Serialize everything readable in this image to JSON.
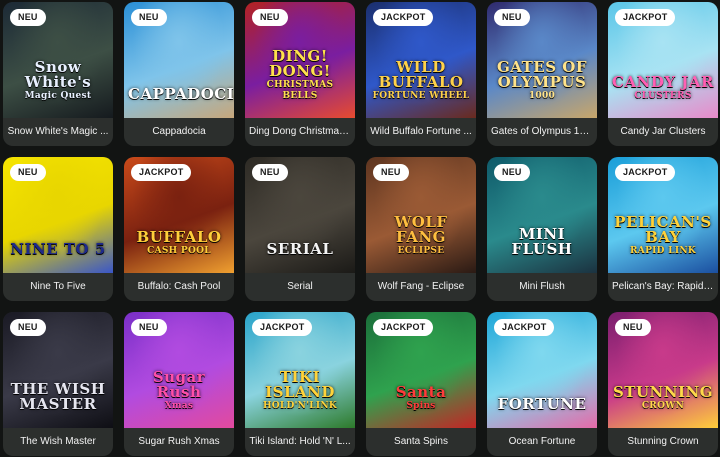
{
  "games": [
    {
      "title": "Snow White's Magic ...",
      "badge": "NEU",
      "logo": "Snow White's",
      "logo_sub": "Magic Quest",
      "colors": [
        "#1c2a36",
        "#3d4f45",
        "#151a1e"
      ],
      "logo_color": "#e8f0ff"
    },
    {
      "title": "Cappadocia",
      "badge": "NEU",
      "logo": "CAPPADOCIA",
      "logo_sub": "",
      "colors": [
        "#2a8fd6",
        "#7fc4ea",
        "#c7a77b"
      ],
      "logo_color": "#ffffff"
    },
    {
      "title": "Ding Dong Christmas...",
      "badge": "NEU",
      "logo": "DING! DONG!",
      "logo_sub": "CHRISTMAS BELLS",
      "colors": [
        "#b32222",
        "#7a1ea0",
        "#e74b2f"
      ],
      "logo_color": "#ffe14d"
    },
    {
      "title": "Wild Buffalo Fortune ...",
      "badge": "JACKPOT",
      "logo": "WILD BUFFALO",
      "logo_sub": "FORTUNE WHEEL",
      "colors": [
        "#1b2f6e",
        "#2f58c9",
        "#6a2a1e"
      ],
      "logo_color": "#ffd24a"
    },
    {
      "title": "Gates of Olympus 10...",
      "badge": "NEU",
      "logo": "GATES OF OLYMPUS",
      "logo_sub": "1000",
      "colors": [
        "#2f2a6e",
        "#5a88c8",
        "#c8a66a"
      ],
      "logo_color": "#ffe38a"
    },
    {
      "title": "Candy Jar Clusters",
      "badge": "JACKPOT",
      "logo": "CANDY JAR",
      "logo_sub": "CLUSTERS",
      "colors": [
        "#5ac6e8",
        "#a8e3f3",
        "#e88ac9"
      ],
      "logo_color": "#ff5fb3"
    },
    {
      "title": "Nine To Five",
      "badge": "NEU",
      "logo": "NINE TO 5",
      "logo_sub": "",
      "colors": [
        "#f5e400",
        "#e8d600",
        "#3a56c9"
      ],
      "logo_color": "#1e2a8a"
    },
    {
      "title": "Buffalo: Cash Pool",
      "badge": "JACKPOT",
      "logo": "BUFFALO",
      "logo_sub": "CASH POOL",
      "colors": [
        "#c94a1a",
        "#7a2110",
        "#f0a030"
      ],
      "logo_color": "#ffcf3a"
    },
    {
      "title": "Serial",
      "badge": "NEU",
      "logo": "SERIAL",
      "logo_sub": "",
      "colors": [
        "#2e2b25",
        "#4b463d",
        "#1b1a17"
      ],
      "logo_color": "#f4f4f4"
    },
    {
      "title": "Wolf Fang - Eclipse",
      "badge": "NEU",
      "logo": "WOLF FANG",
      "logo_sub": "ECLIPSE",
      "colors": [
        "#5e3520",
        "#9a5a35",
        "#2a1a14"
      ],
      "logo_color": "#ffbf3f"
    },
    {
      "title": "Mini Flush",
      "badge": "NEU",
      "logo": "MINI FLUSH",
      "logo_sub": "",
      "colors": [
        "#0f5a6a",
        "#2a8a8c",
        "#1b3240"
      ],
      "logo_color": "#ffffff"
    },
    {
      "title": "Pelican's Bay: Rapid ...",
      "badge": "JACKPOT",
      "logo": "PELICAN'S BAY",
      "logo_sub": "RAPID LINK",
      "colors": [
        "#1a9ed8",
        "#5cc8ef",
        "#1b4fa0"
      ],
      "logo_color": "#ffd23a"
    },
    {
      "title": "The Wish Master",
      "badge": "NEU",
      "logo": "THE WISH MASTER",
      "logo_sub": "",
      "colors": [
        "#1a1a24",
        "#3a3a48",
        "#0e0e14"
      ],
      "logo_color": "#e6e6f0"
    },
    {
      "title": "Sugar Rush Xmas",
      "badge": "NEU",
      "logo": "Sugar Rush",
      "logo_sub": "Xmas",
      "colors": [
        "#7a2fc8",
        "#b14be0",
        "#e24a9e"
      ],
      "logo_color": "#ff4fa8"
    },
    {
      "title": "Tiki Island: Hold 'N' L...",
      "badge": "JACKPOT",
      "logo": "TIKI ISLAND",
      "logo_sub": "HOLD'N'LINK",
      "colors": [
        "#29a3c9",
        "#8ad3df",
        "#2d7a2a"
      ],
      "logo_color": "#ffd33a"
    },
    {
      "title": "Santa Spins",
      "badge": "JACKPOT",
      "logo": "Santa",
      "logo_sub": "Spins",
      "colors": [
        "#1b6e3a",
        "#2fa24e",
        "#c42525"
      ],
      "logo_color": "#ff3b3b"
    },
    {
      "title": "Ocean Fortune",
      "badge": "JACKPOT",
      "logo": "FORTUNE",
      "logo_sub": "",
      "colors": [
        "#1fa6d8",
        "#7fd8ef",
        "#e56aa8"
      ],
      "logo_color": "#ffffff"
    },
    {
      "title": "Stunning Crown",
      "badge": "NEU",
      "logo": "STUNNING",
      "logo_sub": "CROWN",
      "colors": [
        "#7a1e6e",
        "#c83a8a",
        "#ffce3a"
      ],
      "logo_color": "#ffd84a"
    }
  ]
}
